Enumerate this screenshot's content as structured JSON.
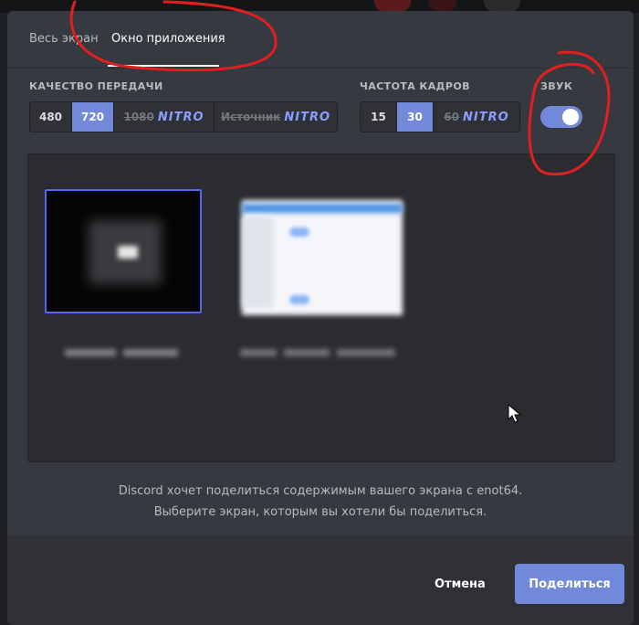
{
  "tabs": [
    {
      "label": "Весь экран",
      "active": false
    },
    {
      "label": "Окно приложения",
      "active": true
    }
  ],
  "quality": {
    "label": "КАЧЕСТВО ПЕРЕДАЧИ",
    "options": [
      {
        "label": "480",
        "selected": false
      },
      {
        "label": "720",
        "selected": true
      },
      {
        "label": "1080",
        "nitro": "NITRO",
        "locked": true
      },
      {
        "label": "Источник",
        "nitro": "NITRO",
        "locked": true
      }
    ]
  },
  "framerate": {
    "label": "ЧАСТОТА КАДРОВ",
    "options": [
      {
        "label": "15",
        "selected": false
      },
      {
        "label": "30",
        "selected": true
      },
      {
        "label": "60",
        "nitro": "NITRO",
        "locked": true
      }
    ]
  },
  "sound": {
    "label": "ЗВУК",
    "enabled": true
  },
  "previews": [
    {
      "label": "",
      "selected": true
    },
    {
      "label": "",
      "selected": false
    }
  ],
  "info": {
    "line1": "Discord хочет поделиться содержимым вашего экрана с enot64.",
    "line2": "Выберите экран, которым вы хотели бы поделиться."
  },
  "footer": {
    "cancel_label": "Отмена",
    "share_label": "Поделиться"
  },
  "colors": {
    "accent": "#7289da",
    "modal_bg": "#36393f",
    "annotation": "#e02020"
  }
}
